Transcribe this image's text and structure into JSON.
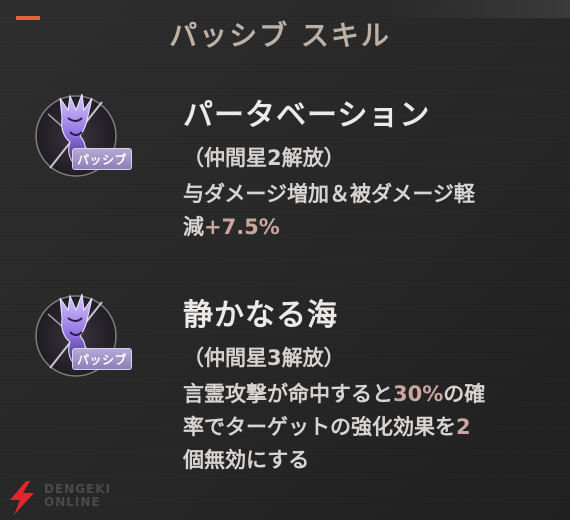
{
  "header": {
    "title": "パッシブ スキル"
  },
  "skills": [
    {
      "name": "パータベーション",
      "unlock": "（仲間星2解放）",
      "desc": [
        "与ダメージ増加＆被ダメージ軽",
        "減",
        "+7.5%",
        ""
      ],
      "badge": "パッシブ",
      "icon": "purple-tentacle-emblem-icon"
    },
    {
      "name": "静かなる海",
      "unlock": "（仲間星3解放）",
      "desc_line1_pre": "言霊攻撃が命中すると",
      "desc_line1_hl": "30%",
      "desc_line1_post": "の確",
      "desc_line2_pre": "率でターゲットの強化効果を",
      "desc_line2_hl": "2",
      "desc_line3": "個無効にする",
      "badge": "パッシブ",
      "icon": "purple-tentacle-emblem-icon"
    }
  ],
  "colors": {
    "accent": "#e2643a",
    "highlight": "#caa6a0",
    "badge": "#9d90c6",
    "header": "#bdb1a6"
  },
  "logo": {
    "icon": "red-lightning-bolt-logo-icon",
    "line1": "DENGEKI",
    "line2": "ONLINE"
  }
}
